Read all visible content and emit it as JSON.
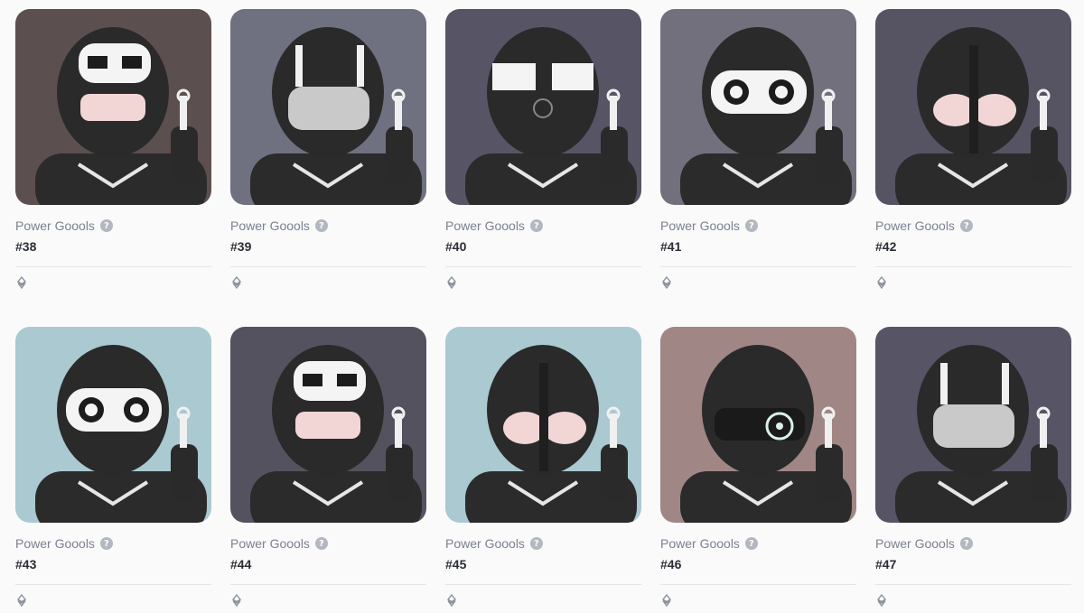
{
  "colors": {
    "page_background": "#fafafa",
    "collection_text": "#7b8190",
    "token_text": "#2a2d33"
  },
  "cards": [
    {
      "collection": "Power Goools",
      "token": "#38",
      "art_background": "#5b4f4f",
      "helmet": "skull"
    },
    {
      "collection": "Power Goools",
      "token": "#39",
      "art_background": "#6f7080",
      "helmet": "visor"
    },
    {
      "collection": "Power Goools",
      "token": "#40",
      "art_background": "#575565",
      "helmet": "striped"
    },
    {
      "collection": "Power Goools",
      "token": "#41",
      "art_background": "#71707c",
      "helmet": "goggles"
    },
    {
      "collection": "Power Goools",
      "token": "#42",
      "art_background": "#565463",
      "helmet": "armored"
    },
    {
      "collection": "Power Goools",
      "token": "#43",
      "art_background": "#aac9d1",
      "helmet": "goggles"
    },
    {
      "collection": "Power Goools",
      "token": "#44",
      "art_background": "#55525f",
      "helmet": "skull"
    },
    {
      "collection": "Power Goools",
      "token": "#45",
      "art_background": "#aac9d1",
      "helmet": "armored"
    },
    {
      "collection": "Power Goools",
      "token": "#46",
      "art_background": "#a08684",
      "helmet": "scope"
    },
    {
      "collection": "Power Goools",
      "token": "#47",
      "art_background": "#575565",
      "helmet": "visor"
    }
  ],
  "icons": {
    "verified": "verified-badge-icon",
    "chain": "ethereum-chain-icon"
  },
  "verified_glyph": "?"
}
